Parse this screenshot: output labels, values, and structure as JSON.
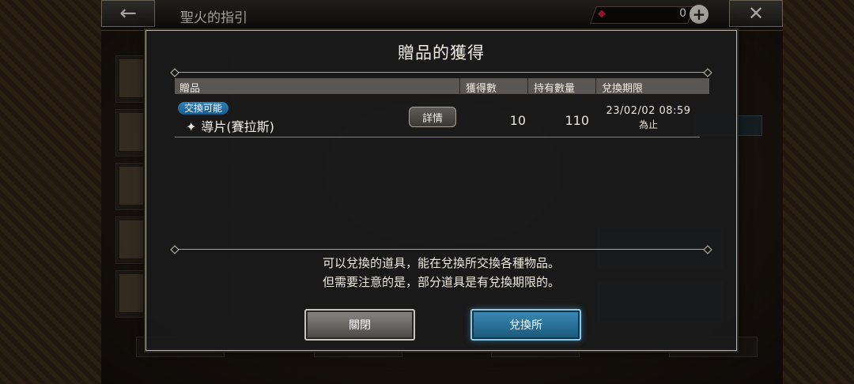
{
  "header": {
    "title": "聖火的指引",
    "currency_value": "0"
  },
  "modal": {
    "title": "贈品的獲得",
    "columns": [
      "贈品",
      "獲得數",
      "持有數量",
      "兌換期限"
    ],
    "row": {
      "tag": "交換可能",
      "name": "導片(賽拉斯)",
      "detail_label": "詳情",
      "obtained": "10",
      "held": "110",
      "expiry_date": "23/02/02 08:59",
      "expiry_suffix": "為止"
    },
    "message_line1": "可以兌換的道具，能在兌換所交換各種物品。",
    "message_line2": "但需要注意的是，部分道具是有兌換期限的。",
    "close_label": "關閉",
    "exchange_label": "兌換所"
  },
  "colors": {
    "accent_blue": "#2e7fb8",
    "gem_red": "#c0203a"
  }
}
